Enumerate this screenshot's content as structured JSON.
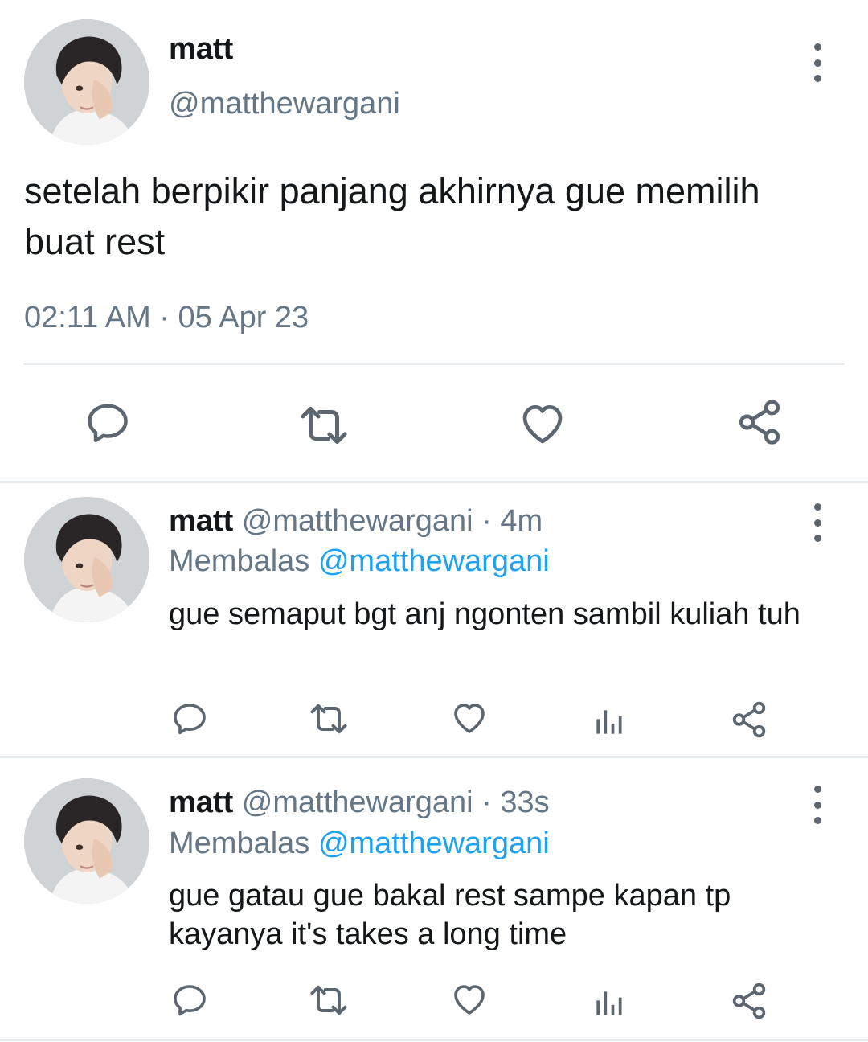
{
  "main_tweet": {
    "name": "matt",
    "handle": "@matthewargani",
    "text": "setelah berpikir panjang akhirnya gue memilih buat rest",
    "timestamp": "02:11 AM · 05 Apr 23"
  },
  "replies": [
    {
      "name": "matt",
      "handle": "@matthewargani",
      "age": "4m",
      "replying_label": "Membalas",
      "replying_to": "@matthewargani",
      "text": "gue semaput bgt anj ngonten sambil kuliah tuh"
    },
    {
      "name": "matt",
      "handle": "@matthewargani",
      "age": "33s",
      "replying_label": "Membalas",
      "replying_to": "@matthewargani",
      "text": "gue gatau gue bakal rest sampe kapan tp kayanya it's takes a long time"
    }
  ],
  "icons": {
    "reply": "reply-icon",
    "retweet": "retweet-icon",
    "like": "heart-icon",
    "analytics": "analytics-icon",
    "share": "share-icon",
    "more": "more-vertical-icon"
  },
  "colors": {
    "text": "#14171a",
    "secondary": "#657786",
    "mention": "#1da1f2",
    "icon": "#5b6670",
    "divider": "#e6ecf0"
  }
}
